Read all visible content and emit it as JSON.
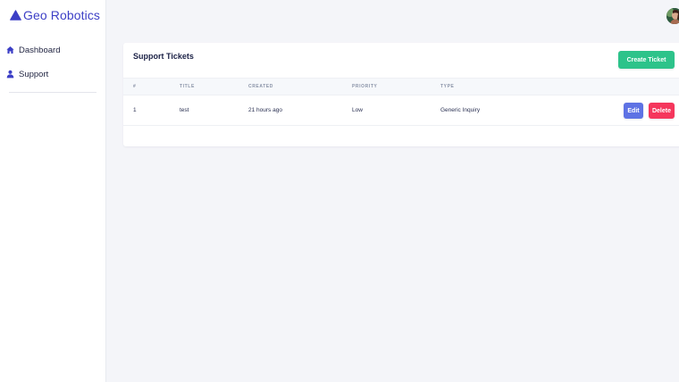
{
  "brand": {
    "name": "Geo Robotics",
    "icon": "triangle-logo-icon",
    "color": "#3c3fc6"
  },
  "sidebar": {
    "items": [
      {
        "label": "Dashboard",
        "icon": "home-icon"
      },
      {
        "label": "Support",
        "icon": "user-icon"
      }
    ]
  },
  "header": {
    "avatar": "user-avatar"
  },
  "card": {
    "title": "Support Tickets",
    "create_button": "Create Ticket"
  },
  "table": {
    "columns": [
      "#",
      "TITLE",
      "CREATED",
      "PRIORITY",
      "TYPE"
    ],
    "rows": [
      {
        "id": "1",
        "title": "test",
        "created": "21 hours ago",
        "priority": "Low",
        "type": "Generic Inquiry",
        "edit_label": "Edit",
        "delete_label": "Delete"
      }
    ]
  },
  "colors": {
    "create_button": "#2dc38a",
    "edit_button": "#5e72e4",
    "delete_button": "#f5365c"
  }
}
